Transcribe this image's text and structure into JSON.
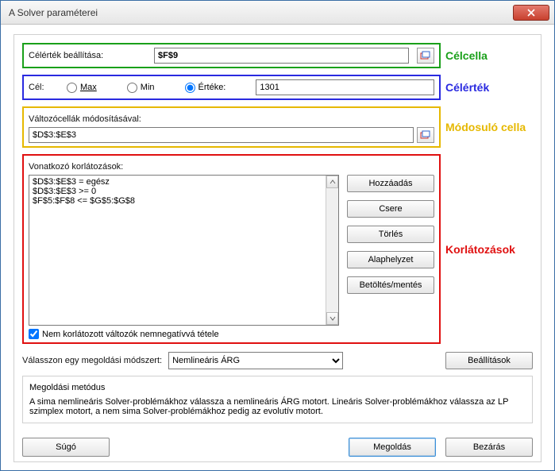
{
  "window": {
    "title": "A Solver paraméterei"
  },
  "target": {
    "label": "Célérték beállítása:",
    "value": "$F$9",
    "annotation": "Célcella"
  },
  "objective": {
    "label": "Cél:",
    "options": {
      "max": "Max",
      "min": "Min",
      "value_of": "Értéke:"
    },
    "selected": "value_of",
    "value": "1301",
    "annotation": "Célérték"
  },
  "changing": {
    "label": "Változócellák módosításával:",
    "value": "$D$3:$E$3",
    "annotation": "Módosuló cella"
  },
  "constraints": {
    "label": "Vonatkozó korlátozások:",
    "items": [
      "$D$3:$E$3 = egész",
      "$D$3:$E$3 >= 0",
      "$F$5:$F$8 <= $G$5:$G$8"
    ],
    "buttons": {
      "add": "Hozzáadás",
      "change": "Csere",
      "delete": "Törlés",
      "reset": "Alaphelyzet",
      "loadsave": "Betöltés/mentés"
    },
    "nonneg_label": "Nem korlátozott változók nemnegatívvá tétele",
    "nonneg_checked": true,
    "annotation": "Korlátozások"
  },
  "method": {
    "label": "Válasszon egy megoldási módszert:",
    "selected": "Nemlineáris ÁRG",
    "options_button": "Beállítások"
  },
  "description": {
    "title": "Megoldási metódus",
    "body": "A sima nemlineáris Solver-problémákhoz válassza a nemlineáris ÁRG motort. Lineáris Solver-problémákhoz válassza az LP szimplex motort, a nem sima Solver-problémákhoz pedig az evolutív motort."
  },
  "footer": {
    "help": "Súgó",
    "solve": "Megoldás",
    "close": "Bezárás"
  }
}
